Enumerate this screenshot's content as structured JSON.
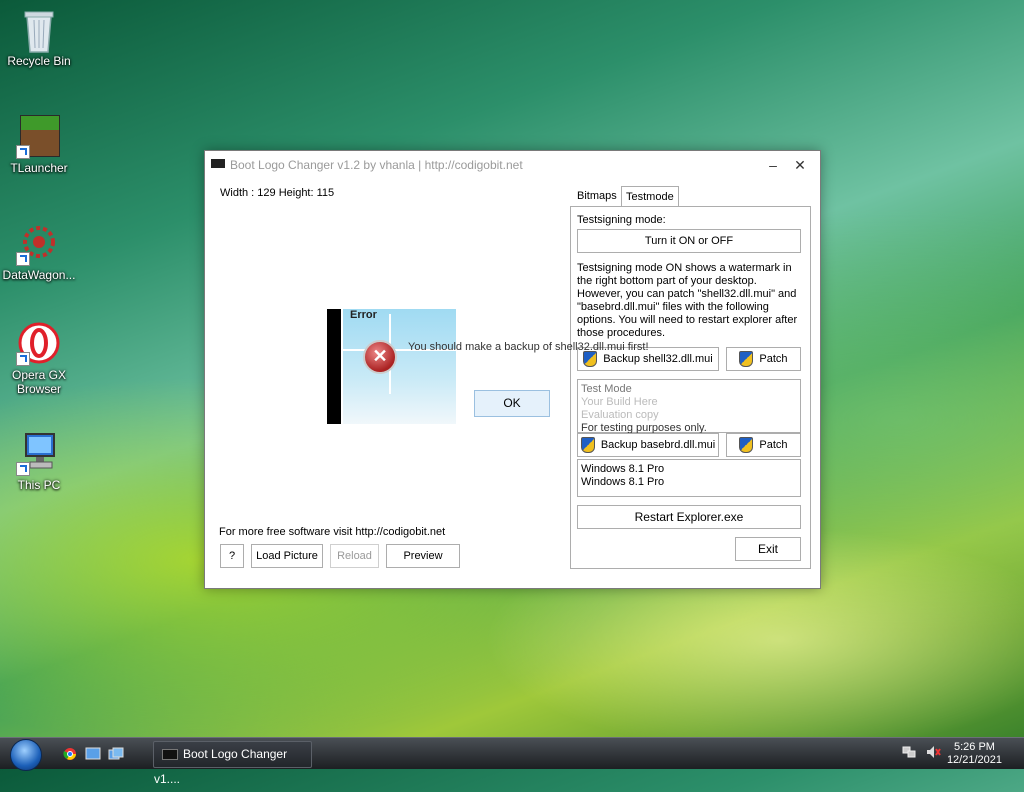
{
  "desktop": {
    "icons": [
      {
        "label": "Recycle Bin"
      },
      {
        "label": "TLauncher"
      },
      {
        "label": "DataWagon..."
      },
      {
        "label": "Opera GX Browser"
      },
      {
        "label": "This PC"
      }
    ]
  },
  "window": {
    "title": "Boot Logo Changer v1.2 by vhanla | http://codigobit.net",
    "minimize": "–",
    "close": "✕",
    "dimensions_text": "Width : 129  Height: 115",
    "footer_text": "For more free software visit  http://codigobit.net",
    "buttons": {
      "help": "?",
      "load_picture": "Load Picture",
      "reload": "Reload",
      "preview": "Preview"
    },
    "tabs": [
      "Bitmaps",
      "Testmode"
    ],
    "testmode": {
      "heading": "Testsigning mode:",
      "toggle_button": "Turn it ON or OFF",
      "description": "Testsigning mode ON shows a watermark in the right bottom part of your desktop. However,  you can patch \"shell32.dll.mui\" and \"basebrd.dll.mui\" files with the following options. You will need to restart explorer after those procedures.",
      "backup_shell32": "Backup shell32.dll.mui",
      "patch1": "Patch",
      "watermark_lines": [
        "Test Mode",
        "Your Build Here",
        "Evaluation copy",
        "For testing purposes only."
      ],
      "backup_basebrd": "Backup basebrd.dll.mui",
      "patch2": "Patch",
      "edition_lines": [
        "Windows 8.1 Pro",
        "Windows 8.1 Pro"
      ],
      "restart_button": "Restart Explorer.exe",
      "exit_button": "Exit"
    }
  },
  "error_dialog": {
    "title": "Error",
    "message": "You should make a backup of shell32.dll.mui first!",
    "ok": "OK"
  },
  "taskbar": {
    "task_label": "Boot Logo Changer v1....",
    "time": "5:26 PM",
    "date": "12/21/2021"
  }
}
